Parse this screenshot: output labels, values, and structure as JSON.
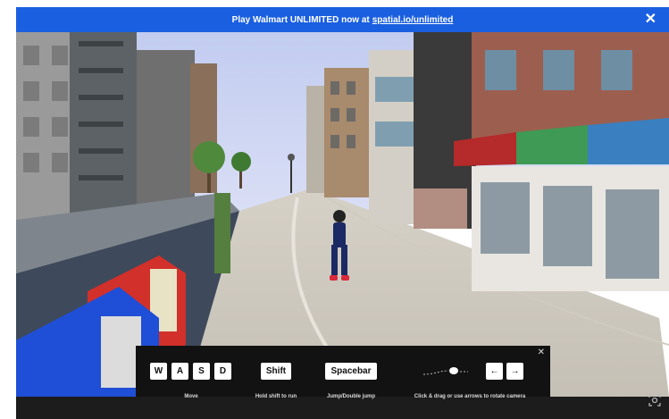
{
  "banner": {
    "text": "Play Walmart UNLIMITED now at",
    "link": "spatial.io/unlimited",
    "close": "✕"
  },
  "controls": {
    "close": "✕",
    "keys": {
      "w": "W",
      "a": "A",
      "s": "S",
      "d": "D",
      "shift": "Shift",
      "spacebar": "Spacebar",
      "left": "←",
      "right": "→"
    },
    "labels": {
      "move": "Move",
      "run": "Hold shift to run",
      "jump": "Jump/Double jump",
      "rotate": "Click & drag or use arrows to rotate camera"
    }
  },
  "colors": {
    "banner": "#1a5fe0",
    "panel": "#121212",
    "sky": "#c9d4f3",
    "awning_red": "#b52a2a",
    "awning_green": "#3f9a55",
    "awning_blue": "#3a7fc0"
  }
}
